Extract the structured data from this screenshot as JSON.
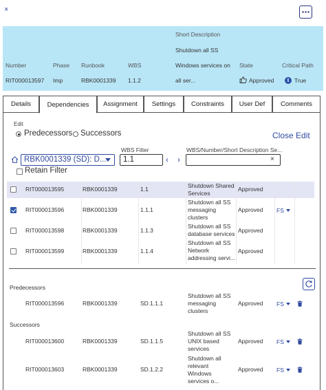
{
  "topbar": {
    "close_glyph": "×",
    "more_icon": "ellipsis-icon"
  },
  "header": {
    "labels": {
      "number": "Number",
      "phase": "Phase",
      "runbook": "Runbook",
      "wbs": "WBS",
      "short_description": "Short Description",
      "state": "State",
      "critical_path": "Critical Path"
    },
    "values": {
      "number": "RIT000013597",
      "phase": "Imp",
      "runbook": "RBK0001339",
      "wbs": "1.1.2",
      "short_description_lines": [
        "Shutdown all SS",
        "Windows services on",
        "all ser..."
      ],
      "state": "Approved",
      "critical_path": "True"
    },
    "background": "#b9e6f7"
  },
  "tabs": [
    {
      "label": "Details",
      "active": false
    },
    {
      "label": "Dependencies",
      "active": true
    },
    {
      "label": "Assignment",
      "active": false
    },
    {
      "label": "Settings",
      "active": false
    },
    {
      "label": "Constraints",
      "active": false
    },
    {
      "label": "User Def",
      "active": false
    },
    {
      "label": "Comments",
      "active": false
    }
  ],
  "edit": {
    "label": "Edit",
    "predecessors_label": "Predecessors",
    "successors_label": "Successors",
    "selected": "Predecessors",
    "close_edit": "Close Edit"
  },
  "filters": {
    "runbook_value": "RBK0001339 (SD): D...",
    "wbs_filter_label": "WBS Filter",
    "wbs_filter_value": "1.1",
    "prev_glyph": "‹",
    "next_glyph": "›",
    "search_label": "WBS/Number/Short Description Se...",
    "search_value": "",
    "clear_glyph": "×",
    "retain_filter_label": "Retain Filter",
    "retain_filter_checked": false
  },
  "candidates": [
    {
      "checked": false,
      "number": "RIT000013595",
      "runbook": "RBK0001339",
      "wbs": "1.1",
      "desc": [
        "Shutdown Shared",
        "Services"
      ],
      "state": "Approved",
      "dep_type": ""
    },
    {
      "checked": true,
      "number": "RIT000013596",
      "runbook": "RBK0001339",
      "wbs": "1.1.1",
      "desc": [
        "Shutdown all SS",
        "messaging",
        "clusters"
      ],
      "state": "Approved",
      "dep_type": "FS"
    },
    {
      "checked": false,
      "number": "RIT000013598",
      "runbook": "RBK0001339",
      "wbs": "1.1.3",
      "desc": [
        "Shutdown all SS",
        "database services"
      ],
      "state": "Approved",
      "dep_type": ""
    },
    {
      "checked": false,
      "number": "RIT000013599",
      "runbook": "RBK0001339",
      "wbs": "1.1.4",
      "desc": [
        "Shutdown all SS",
        "Network",
        "addressing servi..."
      ],
      "state": "Approved",
      "dep_type": ""
    }
  ],
  "predecessors": {
    "label": "Predecessors",
    "rows": [
      {
        "number": "RIT000013596",
        "runbook": "RBK0001339",
        "wbs": "SD.1.1.1",
        "desc": [
          "Shutdown all SS",
          "messaging",
          "clusters"
        ],
        "state": "Approved",
        "dep_type": "FS"
      }
    ]
  },
  "successors": {
    "label": "Successors",
    "rows": [
      {
        "number": "RIT000013600",
        "runbook": "RBK0001339",
        "wbs": "SD.1.1.5",
        "desc": [
          "Shutdown all SS",
          "UNIX based",
          "services"
        ],
        "state": "Approved",
        "dep_type": "FS"
      },
      {
        "number": "RIT000013603",
        "runbook": "RBK0001339",
        "wbs": "SD.1.2.2",
        "desc": [
          "Shutdown all",
          "relevant",
          "Windows",
          "services o..."
        ],
        "state": "Approved",
        "dep_type": "FS"
      }
    ]
  },
  "colors": {
    "accent": "#2f4aa0",
    "highlight_row": "#e3e5f4",
    "checkbox_on": "#2f5aa8"
  }
}
